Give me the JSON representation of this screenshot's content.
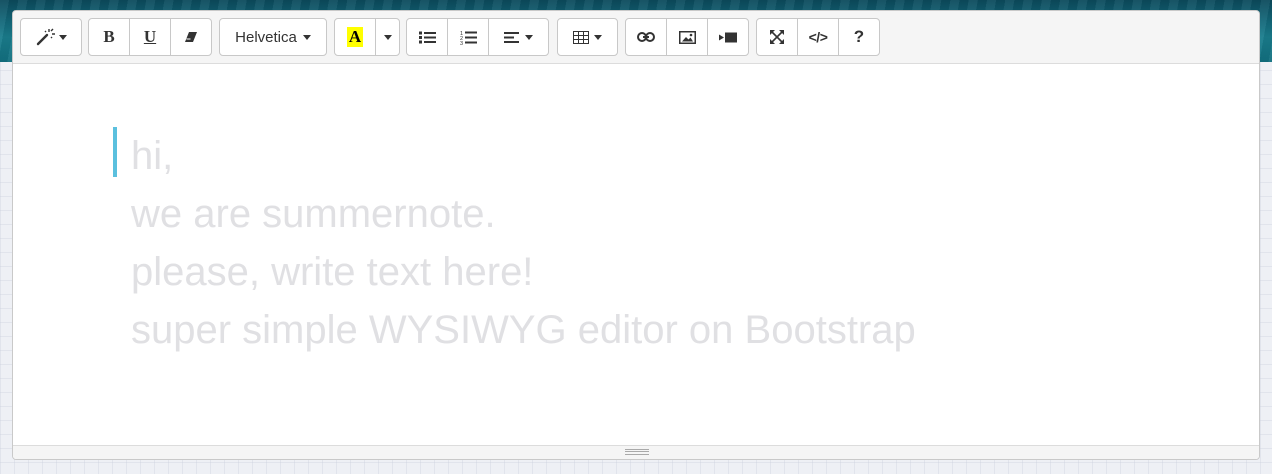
{
  "toolbar": {
    "style_icon": "magic-wand-icon",
    "bold_label": "B",
    "underline_label": "U",
    "clear_format_icon": "eraser-icon",
    "font_name": "Helvetica",
    "color_label": "A",
    "color_swatch": "#ffff00",
    "unordered_list_icon": "bullet-list-icon",
    "ordered_list_icon": "numbered-list-icon",
    "paragraph_icon": "align-left-icon",
    "table_icon": "table-grid-icon",
    "link_icon": "link-icon",
    "picture_icon": "picture-icon",
    "video_icon": "video-icon",
    "fullscreen_icon": "expand-arrows-icon",
    "codeview_label": "</>",
    "help_label": "?"
  },
  "editor": {
    "lines": [
      "hi,",
      "we are summernote.",
      "please, write text here!",
      "super simple WYSIWYG editor on Bootstrap"
    ],
    "placeholder_color": "#e0e0e3",
    "cursor_color": "#5bc0de"
  },
  "colors": {
    "toolbar_bg": "#f5f5f5",
    "border": "#c8c8c8",
    "page_bg": "#eef0f5"
  }
}
